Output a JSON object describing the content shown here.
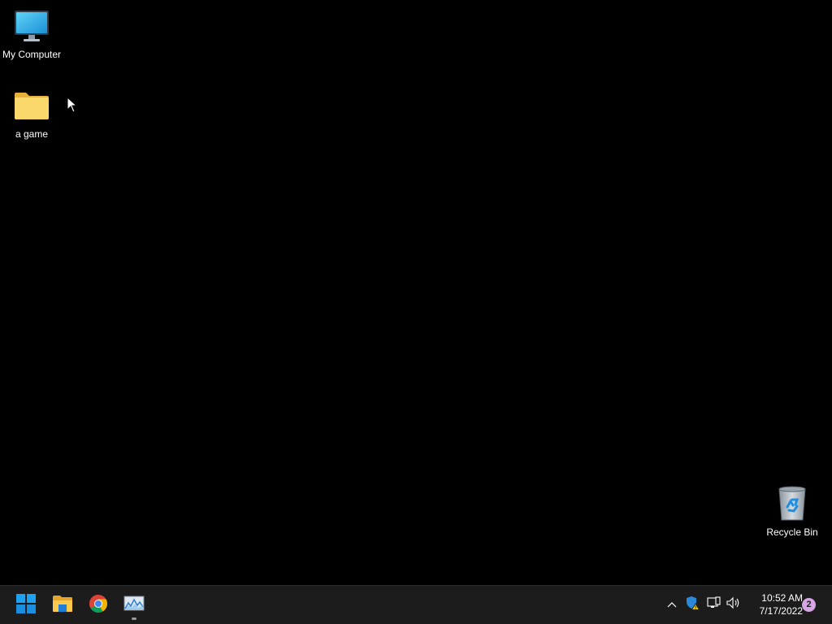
{
  "desktop": {
    "icons": [
      {
        "label": "My Computer",
        "icon": "monitor-icon"
      },
      {
        "label": "a game",
        "icon": "folder-icon"
      },
      {
        "label": "Recycle Bin",
        "icon": "recycle-bin-icon"
      }
    ]
  },
  "taskbar": {
    "pinned": [
      {
        "icon": "windows-start-icon"
      },
      {
        "icon": "file-explorer-icon"
      },
      {
        "icon": "chrome-icon"
      },
      {
        "icon": "resource-monitor-icon",
        "running": true
      }
    ],
    "tray": {
      "icons": [
        "chevron-up-icon",
        "security-warning-icon",
        "network-icon",
        "volume-icon"
      ],
      "time": "10:52 AM",
      "date": "7/17/2022",
      "notifications": "2"
    }
  },
  "colors": {
    "desktop_background": "#000000",
    "taskbar_background": "#1c1c1c",
    "notification_badge": "#d5a6e3",
    "windows_blue": "#0f7fd8",
    "folder_yellow": "#f8d775"
  }
}
